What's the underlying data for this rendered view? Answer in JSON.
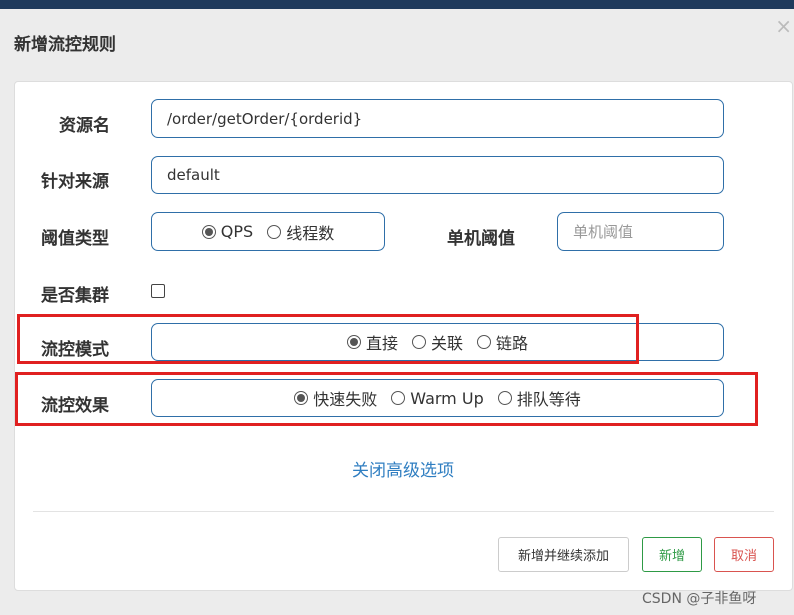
{
  "dialog": {
    "title": "新增流控规则",
    "close_glyph": "×"
  },
  "form": {
    "resource": {
      "label": "资源名",
      "value": "/order/getOrder/{orderid}"
    },
    "limit_app": {
      "label": "针对来源",
      "value": "default"
    },
    "threshold_type": {
      "label": "阈值类型",
      "options": [
        {
          "label": "QPS",
          "selected": true
        },
        {
          "label": "线程数",
          "selected": false
        }
      ]
    },
    "single_threshold": {
      "label": "单机阈值",
      "placeholder": "单机阈值",
      "value": ""
    },
    "cluster": {
      "label": "是否集群",
      "checked": false
    },
    "strategy": {
      "label": "流控模式",
      "options": [
        {
          "label": "直接",
          "selected": true
        },
        {
          "label": "关联",
          "selected": false
        },
        {
          "label": "链路",
          "selected": false
        }
      ]
    },
    "control_behavior": {
      "label": "流控效果",
      "options": [
        {
          "label": "快速失败",
          "selected": true
        },
        {
          "label": "Warm Up",
          "selected": false
        },
        {
          "label": "排队等待",
          "selected": false
        }
      ]
    },
    "advanced_link": "关闭高级选项"
  },
  "footer": {
    "save_continue_label": "新增并继续添加",
    "add_label": "新增",
    "cancel_label": "取消"
  },
  "watermark": "CSDN @子非鱼呀",
  "colors": {
    "header_bar": "#1f3a5c",
    "field_border": "#2f6fa8",
    "highlight_box": "#e02020",
    "link": "#2f7ec1",
    "add_button": "#2e9a45",
    "cancel_button": "#d9534f"
  }
}
